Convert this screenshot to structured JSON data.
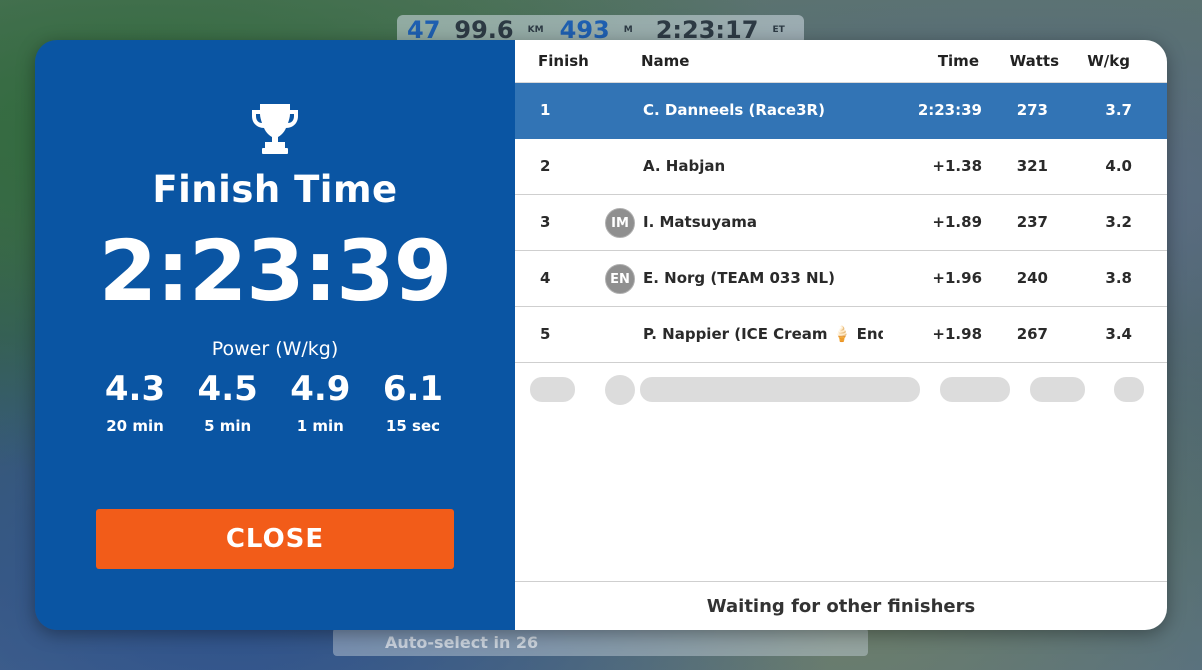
{
  "hud": {
    "speed": "47",
    "distance": "99.6",
    "distance_unit": "KM",
    "elevation": "493",
    "elevation_unit": "M",
    "elapsed": "2:23:17",
    "elapsed_unit": "ET"
  },
  "background_hint": "Auto-select in 26",
  "summary": {
    "title": "Finish Time",
    "time": "2:23:39",
    "power_label": "Power (W/kg)",
    "power": [
      {
        "value": "4.3",
        "duration": "20 min"
      },
      {
        "value": "4.5",
        "duration": "5 min"
      },
      {
        "value": "4.9",
        "duration": "1 min"
      },
      {
        "value": "6.1",
        "duration": "15 sec"
      }
    ],
    "close_label": "CLOSE",
    "trophy_icon": "trophy-icon"
  },
  "results": {
    "headers": {
      "finish": "Finish",
      "name": "Name",
      "time": "Time",
      "watts": "Watts",
      "wkg": "W/kg"
    },
    "rows": [
      {
        "pos": "1",
        "initials": "",
        "name": "C. Danneels (Race3R)",
        "time": "2:23:39",
        "watts": "273",
        "wkg": "3.7"
      },
      {
        "pos": "2",
        "initials": "",
        "name": "A. Habjan",
        "time": "+1.38",
        "watts": "321",
        "wkg": "4.0"
      },
      {
        "pos": "3",
        "initials": "IM",
        "name": "I. Matsuyama",
        "time": "+1.89",
        "watts": "237",
        "wkg": "3.2"
      },
      {
        "pos": "4",
        "initials": "EN",
        "name": "E. Norg (TEAM 033 NL)",
        "time": "+1.96",
        "watts": "240",
        "wkg": "3.8"
      },
      {
        "pos": "5",
        "initials": "",
        "name": "P. Nappier (ICE Cream 🍦 Endura",
        "time": "+1.98",
        "watts": "267",
        "wkg": "3.4"
      }
    ],
    "footer": "Waiting for other finishers"
  },
  "colors": {
    "panel_blue": "#0a55a3",
    "highlight_row": "#3274b5",
    "close_orange": "#f25c19"
  }
}
